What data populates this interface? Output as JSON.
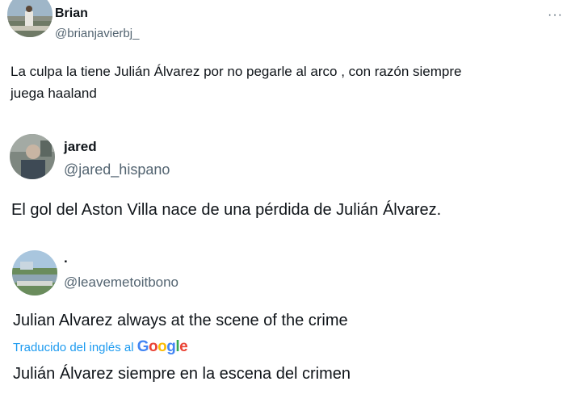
{
  "tweets": [
    {
      "name": "Brian",
      "handle": "@brianjavierbj_",
      "more": "···",
      "text_lines": [
        "La culpa la tiene Julián Álvarez por no pegarle  al arco , con razón siempre",
        "juega haaland"
      ]
    },
    {
      "name": "jared",
      "handle": "@jared_hispano",
      "text": "El gol del Aston Villa nace de una pérdida de Julián Álvarez."
    },
    {
      "name": ".",
      "handle": "@leavemetoitbono",
      "original_text": "Julian Alvarez always at the scene of the crime",
      "translated_label": "Traducido del inglés al",
      "google_letters": [
        "G",
        "o",
        "o",
        "g",
        "l",
        "e"
      ],
      "translated_text": "Julián Álvarez siempre en la escena del crimen"
    }
  ],
  "colors": {
    "text": "#0f1419",
    "secondary": "#536471",
    "link": "#1d9bf0",
    "google_blue": "#4285f4",
    "google_red": "#ea4335",
    "google_yellow": "#fbbc05",
    "google_green": "#34a853"
  },
  "icons": [
    "more-icon"
  ]
}
